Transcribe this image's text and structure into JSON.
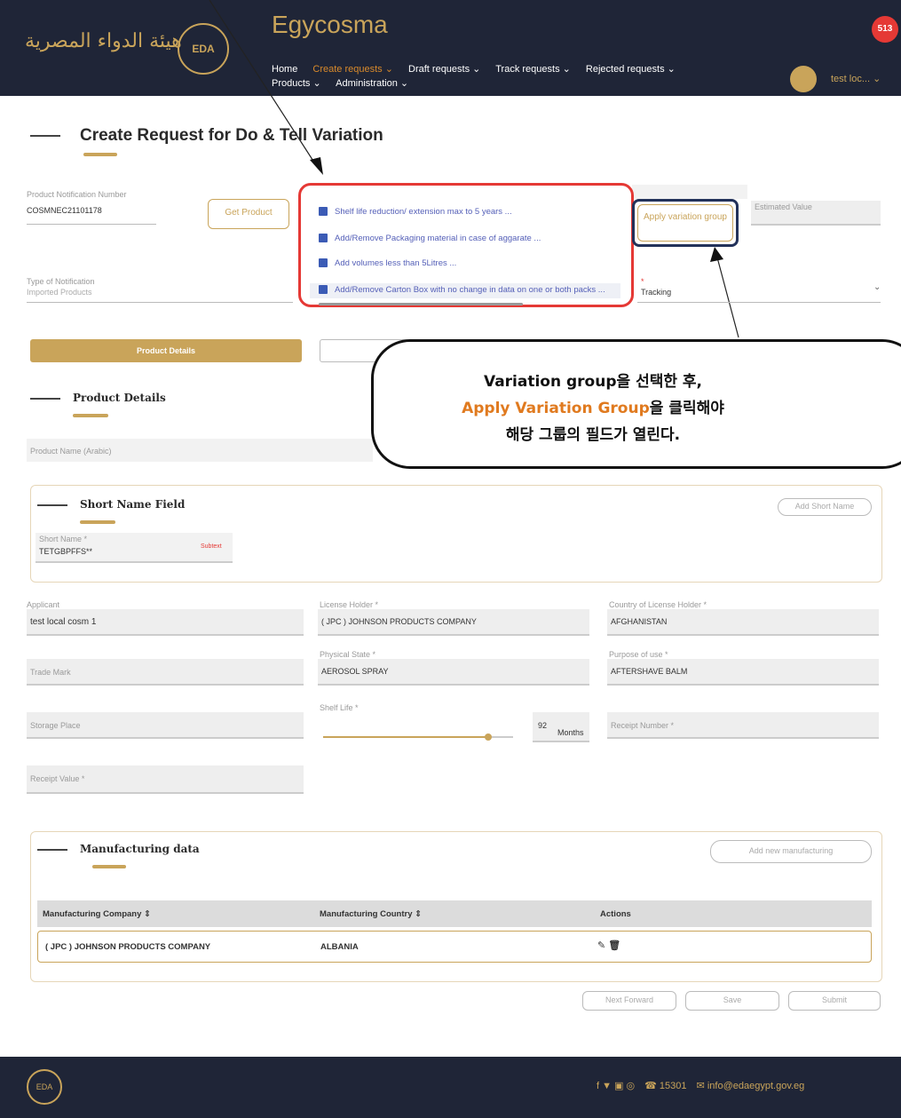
{
  "header": {
    "logo_arabic": "هيئة الدواء المصرية",
    "logo_badge": "EDA",
    "brand": "Egycosma",
    "nav": [
      "Home",
      "Create requests ⌄",
      "Draft requests ⌄",
      "Track requests ⌄",
      "Rejected requests ⌄",
      "Products ⌄",
      "Administration ⌄"
    ],
    "notification_badge": "513",
    "user": "test loc... ⌄"
  },
  "page_title": "Create Request for Do & Tell Variation",
  "top_form": {
    "product_notification_label": "Product Notification Number",
    "product_notification_value": "COSMNEC21101178",
    "get_product": "Get Product",
    "estimated_value_label": "Estimated Value",
    "type_of_notification_label": "Type of Notification",
    "type_of_notification_value": "Imported Products",
    "tracking_value": "Tracking",
    "apply_variation_group": "Apply variation group"
  },
  "variation_options": [
    "Shelf life reduction/ extension max to 5 years ...",
    "Add/Remove Packaging material in case of aggarate ...",
    "Add volumes less than 5Litres ...",
    "Add/Remove Carton Box with no change in data on one or both packs ..."
  ],
  "tabs": {
    "product_details": "Product Details"
  },
  "callout": {
    "line1": "Variation group을 선택한 후,",
    "line2_highlight": "Apply Variation Group",
    "line2_rest": "을 클릭해야",
    "line3": "해당 그룹의 필드가 열린다."
  },
  "product_details": {
    "title": "Product Details",
    "product_name_label": "Product Name (Arabic)"
  },
  "short_name": {
    "title": "Short Name Field",
    "add_button": "Add Short Name",
    "field_label": "Short Name *",
    "field_value": "TETGBPFFS**",
    "badge": "Subtext"
  },
  "fields": {
    "applicant_label": "Applicant",
    "applicant_value": "test local cosm 1",
    "license_holder_label": "License Holder *",
    "license_holder_value": "( JPC ) JOHNSON PRODUCTS COMPANY",
    "country_label": "Country of License Holder *",
    "country_value": "AFGHANISTAN",
    "trade_mark_label": "Trade Mark",
    "physical_state_label": "Physical State *",
    "physical_state_value": "AEROSOL SPRAY",
    "purpose_label": "Purpose of use *",
    "purpose_value": "AFTERSHAVE BALM",
    "storage_label": "Storage Place",
    "shelf_life_label": "Shelf Life *",
    "shelf_life_value": "92",
    "shelf_life_unit": "Months",
    "receipt_number_label": "Receipt Number *",
    "receipt_value_label": "Receipt Value *"
  },
  "manufacturing": {
    "title": "Manufacturing data",
    "add_button": "Add new manufacturing",
    "columns": [
      "Manufacturing Company ⇕",
      "Manufacturing Country ⇕",
      "Actions"
    ],
    "rows": [
      {
        "company": "( JPC ) JOHNSON PRODUCTS COMPANY",
        "country": "ALBANIA",
        "actions": "✎ 🗑"
      }
    ]
  },
  "actions": {
    "next_forward": "Next Forward",
    "save": "Save",
    "submit": "Submit"
  },
  "footer": {
    "logo": "EDA",
    "social": "f  ▼  ▣  ◎",
    "phone": "☎ 15301",
    "email": "✉ info@edaegypt.gov.eg"
  }
}
